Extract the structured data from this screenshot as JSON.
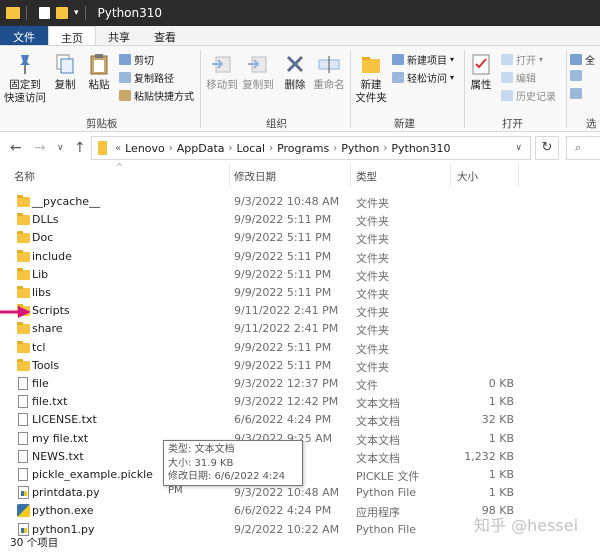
{
  "window": {
    "title": "Python310"
  },
  "ribbon_tabs": [
    "文件",
    "主页",
    "共享",
    "查看"
  ],
  "ribbon": {
    "pin_label": "固定到\n快速访问",
    "copy_label": "复制",
    "paste_label": "粘贴",
    "cut_label": "剪切",
    "copy_path_label": "复制路径",
    "paste_shortcut_label": "粘贴快捷方式",
    "move_to_label": "移动到",
    "copy_to_label": "复制到",
    "delete_label": "删除",
    "rename_label": "重命名",
    "new_folder_label": "新建\n文件夹",
    "new_item_label": "新建项目",
    "easy_access_label": "轻松访问",
    "properties_label": "属性",
    "open_label": "打开",
    "edit_label": "编辑",
    "history_label": "历史记录",
    "select_label": "全",
    "groups": {
      "clipboard": "剪贴板",
      "organize": "组织",
      "new": "新建",
      "open": "打开",
      "select": "选"
    }
  },
  "address": {
    "prefix": "«",
    "crumbs": [
      "Lenovo",
      "AppData",
      "Local",
      "Programs",
      "Python",
      "Python310"
    ]
  },
  "columns": {
    "name": "名称",
    "date": "修改日期",
    "type": "类型",
    "size": "大小"
  },
  "files": [
    {
      "icon": "folder",
      "name": "__pycache__",
      "date": "9/3/2022 10:48 AM",
      "type": "文件夹",
      "size": ""
    },
    {
      "icon": "folder",
      "name": "DLLs",
      "date": "9/9/2022 5:11 PM",
      "type": "文件夹",
      "size": ""
    },
    {
      "icon": "folder",
      "name": "Doc",
      "date": "9/9/2022 5:11 PM",
      "type": "文件夹",
      "size": ""
    },
    {
      "icon": "folder",
      "name": "include",
      "date": "9/9/2022 5:11 PM",
      "type": "文件夹",
      "size": ""
    },
    {
      "icon": "folder",
      "name": "Lib",
      "date": "9/9/2022 5:11 PM",
      "type": "文件夹",
      "size": ""
    },
    {
      "icon": "folder",
      "name": "libs",
      "date": "9/9/2022 5:11 PM",
      "type": "文件夹",
      "size": ""
    },
    {
      "icon": "folder",
      "name": "Scripts",
      "date": "9/11/2022 2:41 PM",
      "type": "文件夹",
      "size": ""
    },
    {
      "icon": "folder",
      "name": "share",
      "date": "9/11/2022 2:41 PM",
      "type": "文件夹",
      "size": ""
    },
    {
      "icon": "folder",
      "name": "tcl",
      "date": "9/9/2022 5:11 PM",
      "type": "文件夹",
      "size": ""
    },
    {
      "icon": "folder",
      "name": "Tools",
      "date": "9/9/2022 5:11 PM",
      "type": "文件夹",
      "size": ""
    },
    {
      "icon": "file",
      "name": "file",
      "date": "9/3/2022 12:37 PM",
      "type": "文件",
      "size": "0 KB"
    },
    {
      "icon": "file",
      "name": "file.txt",
      "date": "9/3/2022 12:42 PM",
      "type": "文本文档",
      "size": "1 KB"
    },
    {
      "icon": "file",
      "name": "LICENSE.txt",
      "date": "6/6/2022 4:24 PM",
      "type": "文本文档",
      "size": "32 KB"
    },
    {
      "icon": "file",
      "name": "my file.txt",
      "date": "9/3/2022 9:25 AM",
      "type": "文本文档",
      "size": "1 KB"
    },
    {
      "icon": "file",
      "name": "NEWS.txt",
      "date": "",
      "type": "文本文档",
      "size": "1,232 KB"
    },
    {
      "icon": "file",
      "name": "pickle_example.pickle",
      "date": "21 AM",
      "type": "PICKLE 文件",
      "size": "1 KB"
    },
    {
      "icon": "py",
      "name": "printdata.py",
      "date": "9/3/2022 10:48 AM",
      "type": "Python File",
      "size": "1 KB"
    },
    {
      "icon": "exe",
      "name": "python.exe",
      "date": "6/6/2022 4:24 PM",
      "type": "应用程序",
      "size": "98 KB"
    },
    {
      "icon": "py",
      "name": "python1.py",
      "date": "9/2/2022 10:22 AM",
      "type": "Python File",
      "size": ""
    }
  ],
  "tooltip": {
    "type": "类型: 文本文档",
    "size": "大小: 31.9 KB",
    "date": "修改日期: 6/6/2022 4:24 PM"
  },
  "status": {
    "count": "30 个项目"
  },
  "watermark": "知乎 @hessei",
  "colors": {
    "file_tab": "#1e4e8c",
    "folder": "#f6c343",
    "arrow": "#d6157a",
    "titlebar": "#2b2b2b"
  }
}
